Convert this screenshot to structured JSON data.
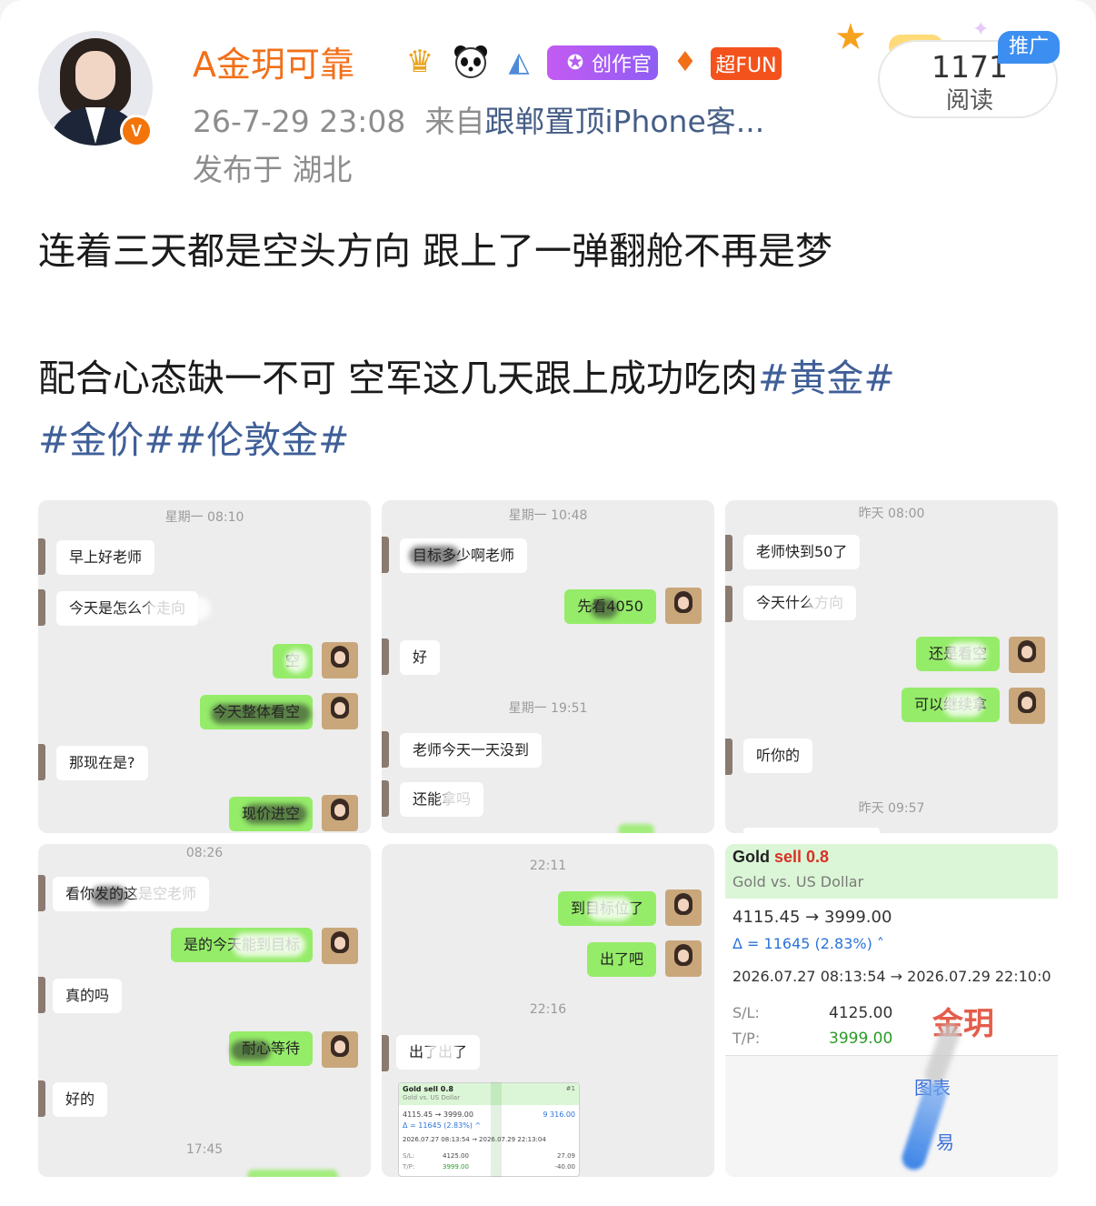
{
  "post": {
    "author": {
      "name": "A金玥可靠",
      "verified_badge": "V",
      "badges": [
        {
          "name": "crown-badge",
          "glyph": "♛"
        },
        {
          "name": "panda-badge",
          "glyph": "🐼"
        },
        {
          "name": "shark-badge",
          "glyph": "◭"
        },
        {
          "name": "creator-badge",
          "label": "创作官",
          "glyph": "✪"
        },
        {
          "name": "diamond-badge",
          "glyph": "♦"
        },
        {
          "name": "superfun-badge",
          "label": "超FUN"
        }
      ]
    },
    "timestamp": "26-7-29 23:08",
    "source_prefix": "来自",
    "source": "跟郸置顶iPhone客...",
    "location": "发布于 湖北",
    "read_count": "1171",
    "read_label": "阅读",
    "promo_label": "推广",
    "text_line1": "连着三天都是空头方向  跟上了一弹翻舱不再是梦",
    "text_line2_plain": "配合心态缺一不可  空军这几天跟上成功吃肉",
    "hashtags": [
      "#黄金#",
      "#金价#",
      "#伦敦金#"
    ]
  },
  "images": {
    "t1": {
      "time": "星期一 08:10",
      "messages": [
        "早上好老师",
        "今天是怎么个走向",
        "空",
        "今天整体看空",
        "那现在是?",
        "现价进空"
      ]
    },
    "t2": {
      "time1": "星期一 10:48",
      "time2": "星期一 19:51",
      "messages": [
        "目标多少啊老师",
        "先看4050",
        "好",
        "老师今天一天没到",
        "还能拿吗"
      ]
    },
    "t3": {
      "time1": "昨天 08:00",
      "time2": "昨天 09:57",
      "messages": [
        "老师快到50了",
        "今天什么方向",
        "还是看空",
        "可以继续拿",
        "听你的"
      ]
    },
    "t4": {
      "time1": "08:26",
      "time2": "17:45",
      "messages": [
        "看你发的这是空老师",
        "是的今天能到目标",
        "真的吗",
        "耐心等待",
        "好的"
      ]
    },
    "t5": {
      "time1": "22:11",
      "time2": "22:16",
      "messages": [
        "到目标位了",
        "出了吧",
        "出了出了"
      ],
      "mini": {
        "title": "Gold sell 0.8",
        "subtitle": "Gold vs. US Dollar",
        "prices": "4115.45 → 3999.00",
        "profit": "9 316.00",
        "delta": "Δ = 11645 (2.83%) ^",
        "dates": "2026.07.27 08:13:54 → 2026.07.29 22:13:04",
        "sl_label": "S/L:",
        "sl": "4125.00",
        "tp_label": "T/P:",
        "tp": "3999.00",
        "right1": "27.09",
        "right2": "-40.00",
        "id": "#1"
      }
    },
    "t6": {
      "title_a": "Gold",
      "title_b": "sell 0.8",
      "subtitle": "Gold vs. US Dollar",
      "prices": "4115.45 → 3999.00",
      "delta": "Δ = 11645 (2.83%) ˄",
      "dates": "2026.07.27 08:13:54 → 2026.07.29 22:10:0",
      "sl_label": "S/L:",
      "sl": "4125.00",
      "tp_label": "T/P:",
      "tp": "3999.00",
      "watermark": "金玥",
      "link1": "图表",
      "link2": "易"
    }
  }
}
